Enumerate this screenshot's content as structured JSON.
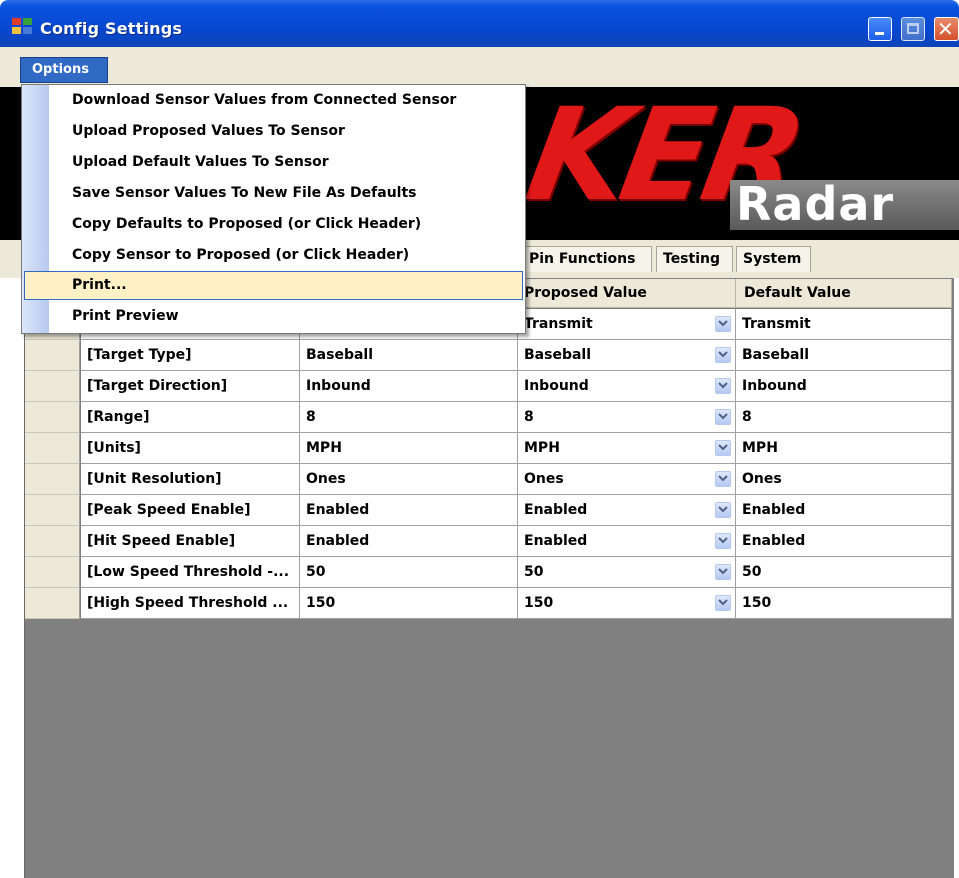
{
  "window": {
    "title": "Config Settings"
  },
  "menubar": {
    "options_label": "Options"
  },
  "options_menu": {
    "items": [
      "Download Sensor Values from Connected Sensor",
      "Upload Proposed Values To Sensor",
      "Upload Default Values To Sensor",
      "Save Sensor Values To New File As Defaults",
      "Copy Defaults to Proposed (or Click Header)",
      "Copy Sensor to Proposed (or Click Header)",
      "Print...",
      "Print Preview"
    ],
    "highlighted": "Print..."
  },
  "banner": {
    "brand_partial": "KER",
    "brand_sub": "Radar"
  },
  "tabs": [
    "Pin Functions",
    "Testing",
    "System"
  ],
  "grid": {
    "headers": {
      "proposed": "Proposed Value",
      "default": "Default Value"
    },
    "rows": [
      {
        "setting": "",
        "sensor": "",
        "proposed": "Transmit",
        "default": "Transmit"
      },
      {
        "setting": "[Target Type]",
        "sensor": "Baseball",
        "proposed": "Baseball",
        "default": "Baseball"
      },
      {
        "setting": "[Target Direction]",
        "sensor": "Inbound",
        "proposed": "Inbound",
        "default": "Inbound"
      },
      {
        "setting": "[Range]",
        "sensor": "8",
        "proposed": "8",
        "default": "8"
      },
      {
        "setting": "[Units]",
        "sensor": "MPH",
        "proposed": "MPH",
        "default": "MPH"
      },
      {
        "setting": "[Unit Resolution]",
        "sensor": "Ones",
        "proposed": "Ones",
        "default": "Ones"
      },
      {
        "setting": "[Peak Speed Enable]",
        "sensor": "Enabled",
        "proposed": "Enabled",
        "default": "Enabled"
      },
      {
        "setting": "[Hit Speed Enable]",
        "sensor": "Enabled",
        "proposed": "Enabled",
        "default": "Enabled"
      },
      {
        "setting": "[Low Speed Threshold -...",
        "sensor": "50",
        "proposed": "50",
        "default": "50"
      },
      {
        "setting": "[High Speed Threshold ...",
        "sensor": "150",
        "proposed": "150",
        "default": "150"
      }
    ]
  },
  "colors": {
    "titlebar": "#0a54e0",
    "menu_highlight": "#fff0c6",
    "options_selected": "#316ac5",
    "brand_red": "#e01818"
  }
}
